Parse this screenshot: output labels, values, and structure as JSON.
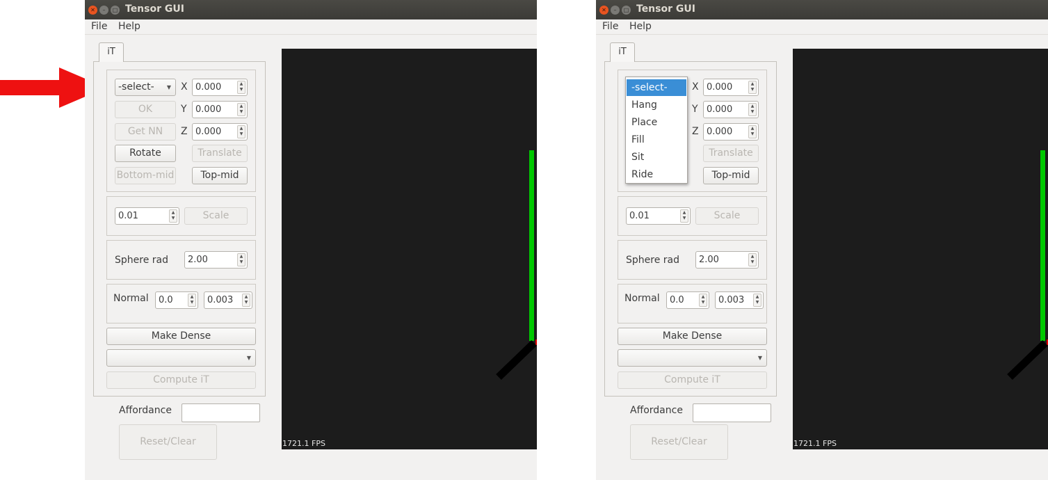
{
  "window": {
    "title": "Tensor GUI"
  },
  "menu": {
    "file": "File",
    "help": "Help"
  },
  "tab": {
    "label": "iT"
  },
  "panel": {
    "select_value": "-select-",
    "x_label": "X",
    "x_value": "0.000",
    "y_label": "Y",
    "y_value": "0.000",
    "z_label": "Z",
    "z_value": "0.000",
    "ok": "OK",
    "get_nn": "Get NN",
    "rotate": "Rotate",
    "translate": "Translate",
    "bottom_mid": "Bottom-mid",
    "top_mid": "Top-mid",
    "scale_value": "0.01",
    "scale": "Scale",
    "sphere_label": "Sphere rad",
    "sphere_value": "2.00",
    "normal_label": "Normal",
    "normal_a": "0.0",
    "normal_b": "0.003",
    "make_dense": "Make Dense",
    "compute": "Compute iT",
    "affordance_label": "Affordance",
    "reset": "Reset/Clear"
  },
  "viewport": {
    "fps": "1721.1 FPS"
  },
  "dropdown": {
    "options": [
      "-select-",
      "Hang",
      "Place",
      "Fill",
      "Sit",
      "Ride"
    ],
    "selected": "-select-"
  },
  "colors": {
    "accent": "#e95420",
    "axis_y": "#00c800",
    "axis_x": "#e00000",
    "selection": "#3a8ed6",
    "arrow": "#ee1111"
  }
}
